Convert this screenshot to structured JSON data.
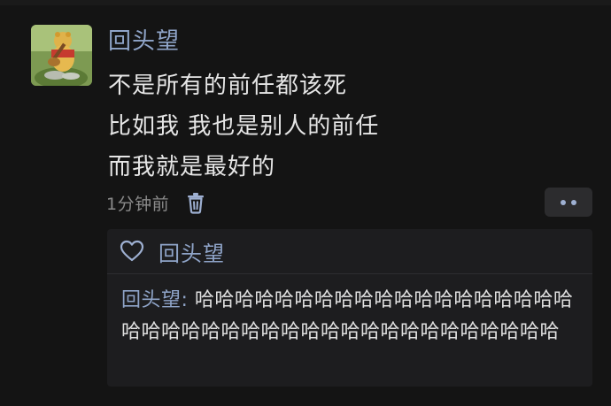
{
  "post": {
    "author": "回头望",
    "lines": [
      "不是所有的前任都该死",
      "比如我 我也是别人的前任",
      "而我就是最好的"
    ],
    "time": "1分钟前"
  },
  "actions": {
    "delete_icon": "trash-icon",
    "more_icon": "more-dots-icon"
  },
  "reply_box": {
    "like_icon": "heart-outline-icon",
    "liker": "回头望",
    "comment_author": "回头望",
    "comment_sep": ": ",
    "comment_text": "哈哈哈哈哈哈哈哈哈哈哈哈哈哈哈哈哈哈哈哈哈哈哈哈哈哈哈哈哈哈哈哈哈哈哈哈哈哈哈哈哈"
  },
  "colors": {
    "background": "#141414",
    "name_blue": "#8fa4c8",
    "text": "#e6e6e6",
    "muted": "#8a8a8a",
    "reply_bg": "#1d1d1f"
  }
}
